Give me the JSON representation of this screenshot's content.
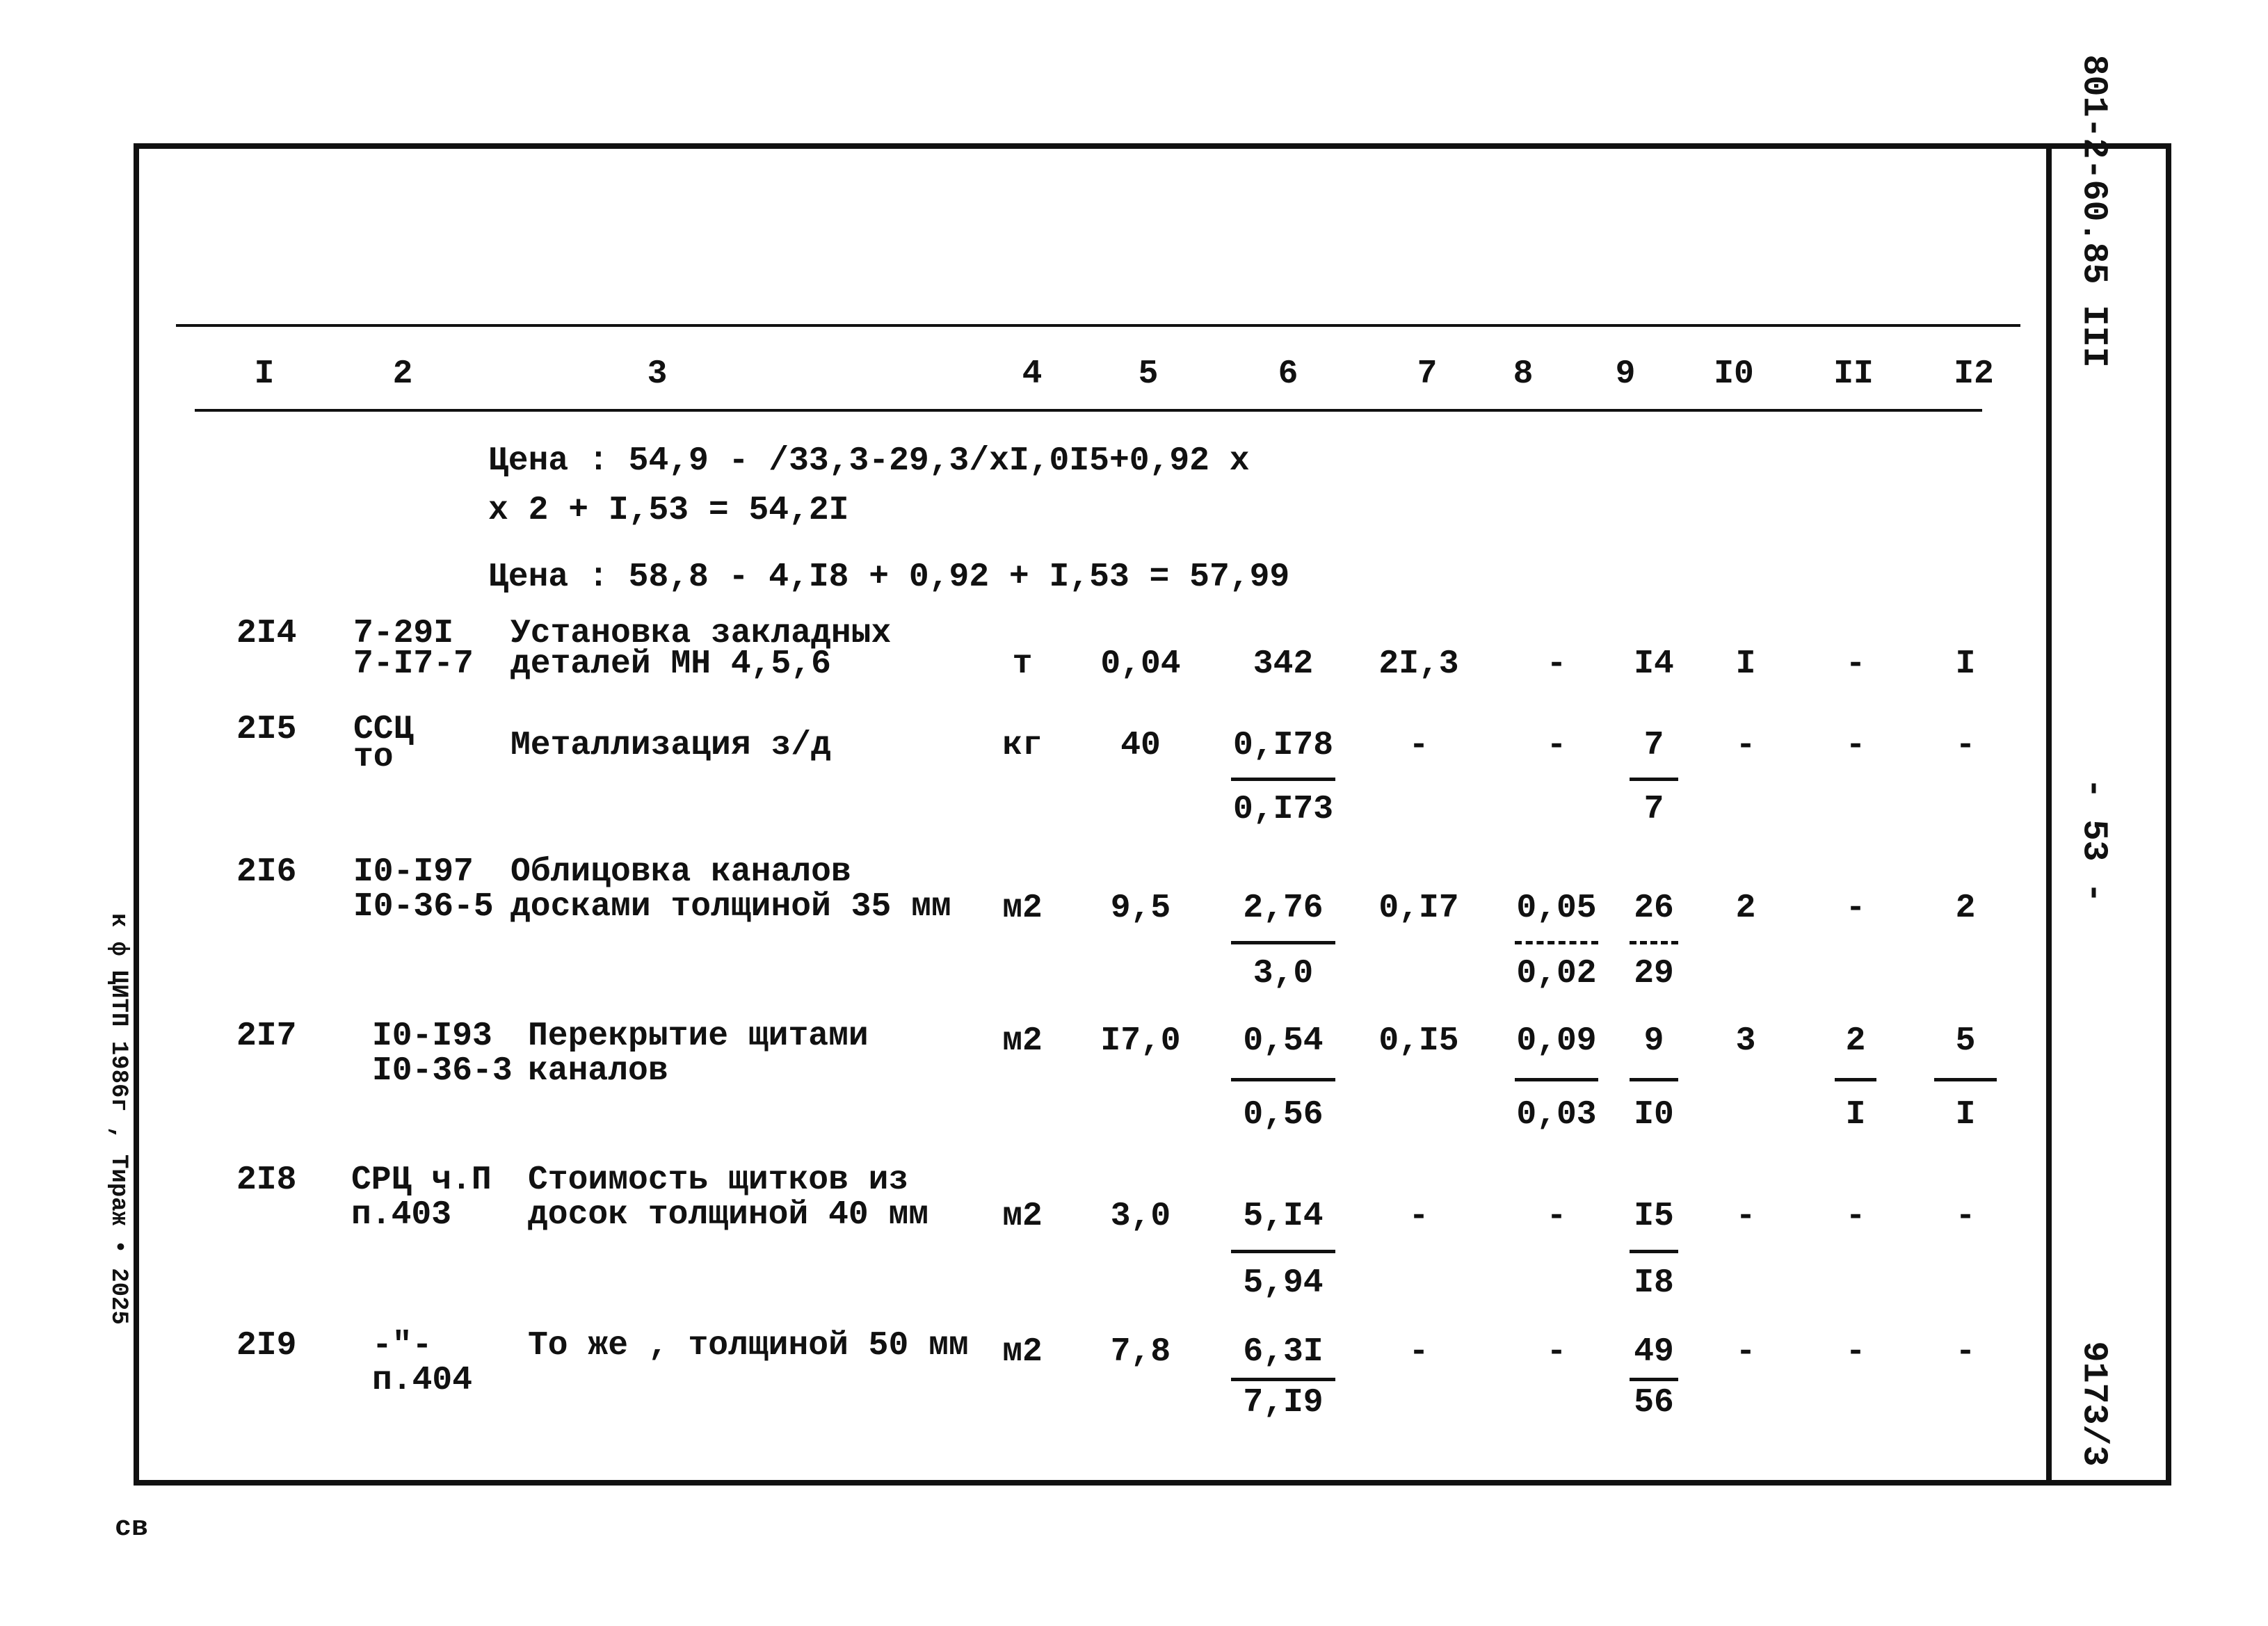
{
  "header_numbers": [
    "I",
    "2",
    "3",
    "4",
    "5",
    "6",
    "7",
    "8",
    "9",
    "I0",
    "II",
    "I2"
  ],
  "formulas": [
    "Цена : 54,9 - /33,3-29,3/хI,0I5+0,92 х",
    "х 2 + I,53 = 54,2I",
    "Цена : 58,8 - 4,I8 + 0,92 + I,53 = 57,99"
  ],
  "rows": [
    {
      "no": "2I4",
      "code": [
        "7-29I",
        "7-I7-7"
      ],
      "desc": [
        "Установка закладных",
        "деталей МН 4,5,6"
      ],
      "unit": "т",
      "qty": "0,04",
      "c6": {
        "num": "342"
      },
      "c7": {
        "num": "2I,3"
      },
      "c8": {
        "num": "-"
      },
      "c9": {
        "num": "I4"
      },
      "c10": {
        "num": "I"
      },
      "c11": {
        "num": "-"
      },
      "c12": {
        "num": "I"
      }
    },
    {
      "no": "2I5",
      "code": [
        "ССЦ",
        "то"
      ],
      "desc": [
        "Металлизация з/д"
      ],
      "unit": "кг",
      "qty": "40",
      "c6": {
        "num": "0,I78",
        "den": "0,I73"
      },
      "c7": {
        "num": "-"
      },
      "c8": {
        "num": "-"
      },
      "c9": {
        "num": "7",
        "den": "7"
      },
      "c10": {
        "num": "-"
      },
      "c11": {
        "num": "-"
      },
      "c12": {
        "num": "-"
      }
    },
    {
      "no": "2I6",
      "code": [
        "I0-I97",
        "I0-36-5"
      ],
      "desc": [
        "Облицовка каналов",
        "досками толщиной 35 мм"
      ],
      "unit": "м2",
      "qty": "9,5",
      "c6": {
        "num": "2,76",
        "den": "3,0"
      },
      "c7": {
        "num": "0,I7"
      },
      "c8": {
        "num": "0,05",
        "den": "0,02",
        "dashed": true
      },
      "c9": {
        "num": "26",
        "den": "29",
        "dashed": true
      },
      "c10": {
        "num": "2"
      },
      "c11": {
        "num": "-"
      },
      "c12": {
        "num": "2"
      }
    },
    {
      "no": "2I7",
      "code": [
        "I0-I93",
        "I0-36-3"
      ],
      "desc": [
        "Перекрытие щитами",
        "каналов"
      ],
      "unit": "м2",
      "qty": "I7,0",
      "c6": {
        "num": "0,54",
        "den": "0,56"
      },
      "c7": {
        "num": "0,I5"
      },
      "c8": {
        "num": "0,09",
        "den": "0,03"
      },
      "c9": {
        "num": "9",
        "den": "I0"
      },
      "c10": {
        "num": "3"
      },
      "c11": {
        "num": "2",
        "den": "I"
      },
      "c12": {
        "num": "5",
        "den": "I"
      }
    },
    {
      "no": "2I8",
      "code": [
        "СРЦ ч.П",
        "п.403"
      ],
      "desc": [
        "Стоимость щитков из",
        "досок толщиной 40 мм"
      ],
      "unit": "м2",
      "qty": "3,0",
      "c6": {
        "num": "5,I4",
        "den": "5,94"
      },
      "c7": {
        "num": "-"
      },
      "c8": {
        "num": "-"
      },
      "c9": {
        "num": "I5",
        "den": "I8"
      },
      "c10": {
        "num": "-"
      },
      "c11": {
        "num": "-"
      },
      "c12": {
        "num": "-"
      }
    },
    {
      "no": "2I9",
      "code": [
        "-\"-",
        "п.404"
      ],
      "desc": [
        "То же , толщиной 50 мм"
      ],
      "unit": "м2",
      "qty": "7,8",
      "c6": {
        "num": "6,3I",
        "den": "7,I9"
      },
      "c7": {
        "num": "-"
      },
      "c8": {
        "num": "-"
      },
      "c9": {
        "num": "49",
        "den": "56"
      },
      "c10": {
        "num": "-"
      },
      "c11": {
        "num": "-"
      },
      "c12": {
        "num": "-"
      }
    }
  ],
  "side_stamp": {
    "doc_code": "801-2-60.85 III",
    "page": "- 53 -",
    "order": "9173/3"
  },
  "margin_note": "к ф ЦИТП 1986г , Тираж • 2025",
  "footer_mark": "св"
}
